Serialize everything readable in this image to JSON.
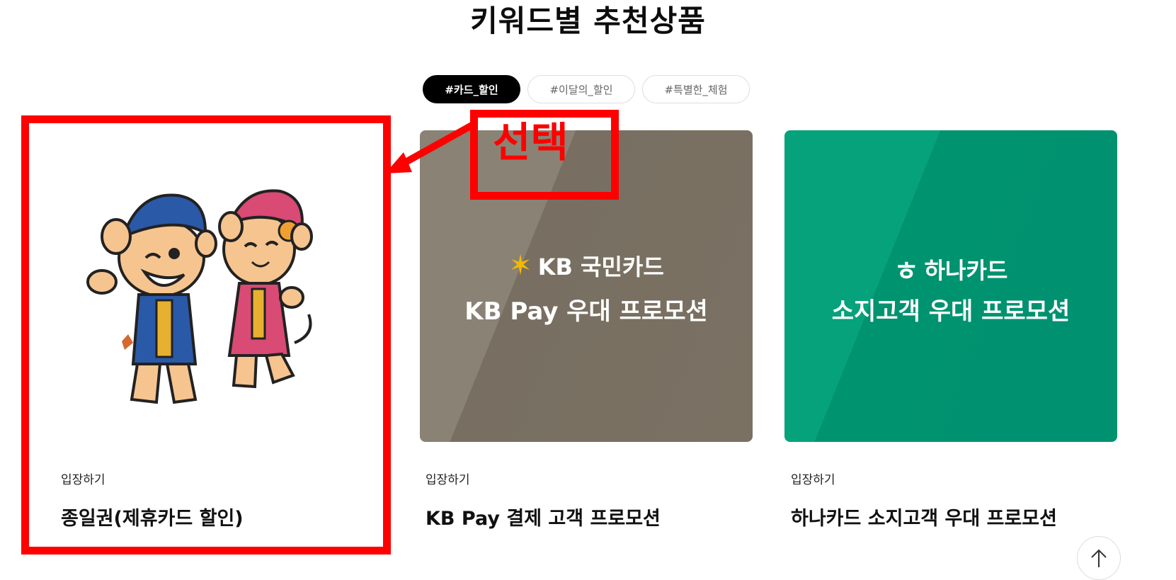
{
  "page": {
    "title": "키워드별 추천상품"
  },
  "tabs": [
    {
      "label": "#카드_할인",
      "active": true
    },
    {
      "label": "#이달의_할인",
      "active": false
    },
    {
      "label": "#특별한_체험",
      "active": false
    }
  ],
  "cards": [
    {
      "image": "mascot-characters",
      "label": "입장하기",
      "name": "종일권(제휴카드 할인)"
    },
    {
      "image": "kb-card-banner",
      "brand_logo_text": "KB 국민카드",
      "brand_tagline": "KB Pay 우대 프로모션",
      "label": "입장하기",
      "name": "KB Pay 결제 고객 프로모션"
    },
    {
      "image": "hana-card-banner",
      "brand_logo_text": "하나카드",
      "brand_tagline": "소지고객 우대 프로모션",
      "label": "입장하기",
      "name": "하나카드 소지고객 우대 프로모션"
    }
  ],
  "annotation": {
    "select_label": "선택",
    "color": "#ff0000"
  },
  "colors": {
    "kb_bg": "#7d7466",
    "hana_bg": "#009a73",
    "kb_logo": "#f5b800",
    "active_tab": "#000000"
  },
  "icons": {
    "scroll_top": "arrow-up-icon"
  }
}
